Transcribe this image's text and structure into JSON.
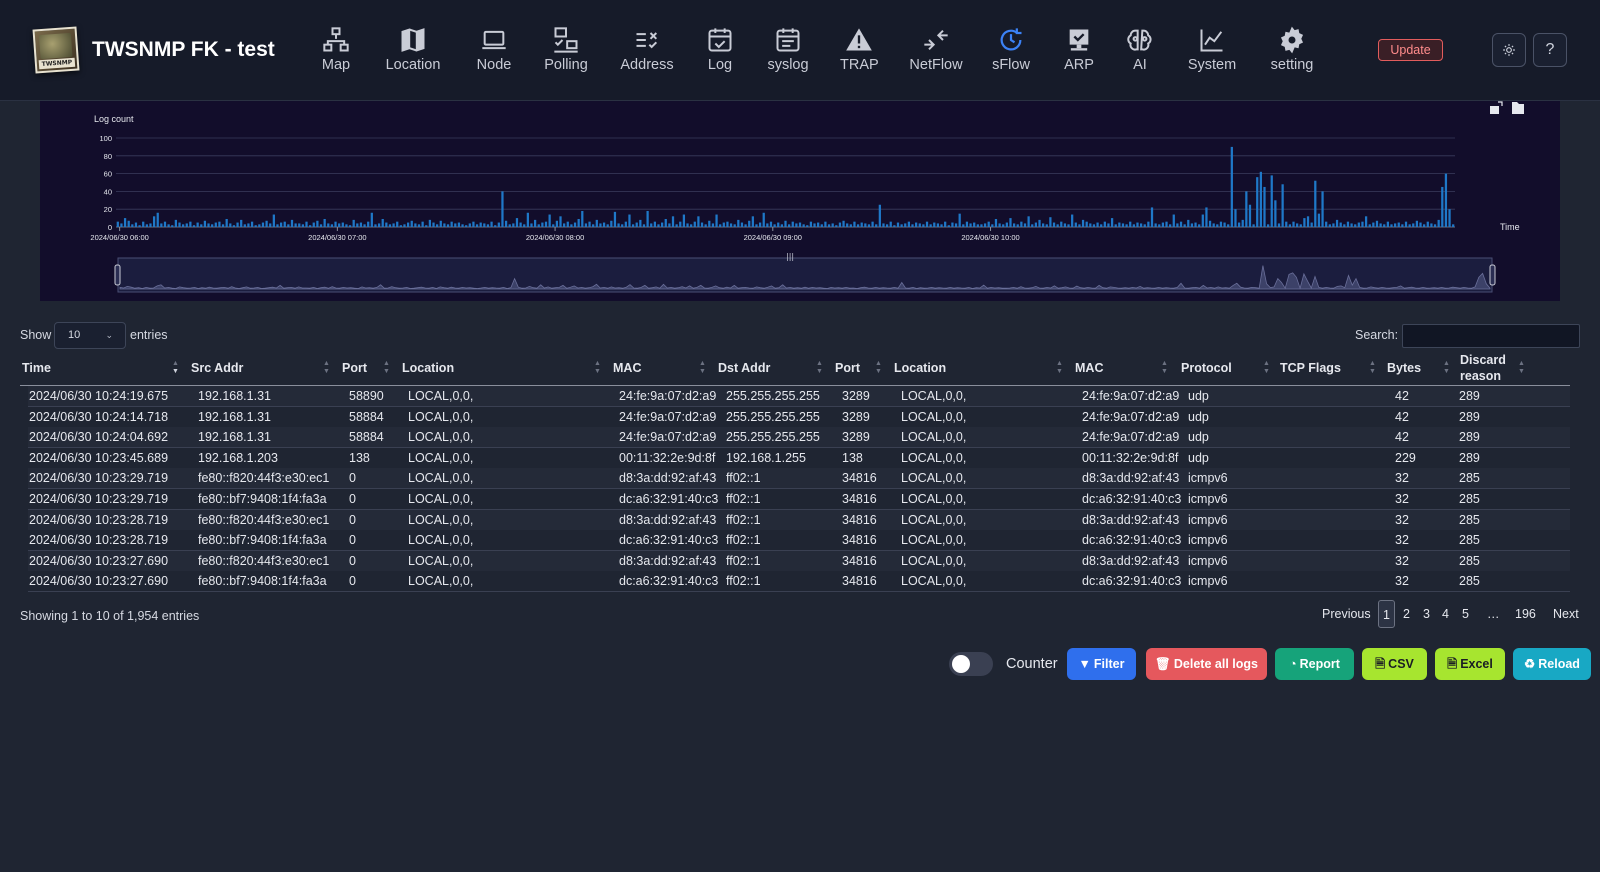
{
  "header": {
    "logo_text": "TWSNMP",
    "title": "TWSNMP FK - test",
    "nav": [
      {
        "label": "Map",
        "icon": "map-network-icon"
      },
      {
        "label": "Location",
        "icon": "map-icon"
      },
      {
        "label": "Node",
        "icon": "laptop-icon"
      },
      {
        "label": "Polling",
        "icon": "polling-icon"
      },
      {
        "label": "Address",
        "icon": "address-icon"
      },
      {
        "label": "Log",
        "icon": "calendar-check-icon"
      },
      {
        "label": "syslog",
        "icon": "calendar-icon"
      },
      {
        "label": "TRAP",
        "icon": "warning-icon"
      },
      {
        "label": "NetFlow",
        "icon": "arrows-icon"
      },
      {
        "label": "sFlow",
        "icon": "clock-icon",
        "active": true
      },
      {
        "label": "ARP",
        "icon": "monitor-check-icon"
      },
      {
        "label": "AI",
        "icon": "brain-icon"
      },
      {
        "label": "System",
        "icon": "chart-line-icon"
      },
      {
        "label": "setting",
        "icon": "gear-icon"
      }
    ],
    "update_label": "Update",
    "theme_icon": "sun-icon",
    "help_label": "?"
  },
  "chart_data": {
    "type": "bar",
    "ylabel": "Log count",
    "xlabel": "Time",
    "ylim": [
      0,
      100
    ],
    "y_ticks": [
      "0",
      "20",
      "40",
      "60",
      "80",
      "100"
    ],
    "x_ticks": [
      "2024/06/30 06:00",
      "2024/06/30 07:00",
      "2024/06/30 08:00",
      "2024/06/30 09:00",
      "2024/06/30 10:00"
    ],
    "x_range": [
      "2024/06/30 05:59",
      "2024/06/30 10:24"
    ],
    "bar_interval_minutes": 1,
    "values": [
      6,
      4,
      10,
      7,
      3,
      5,
      2,
      6,
      3,
      4,
      12,
      16,
      4,
      6,
      3,
      2,
      8,
      5,
      3,
      4,
      6,
      2,
      5,
      3,
      7,
      4,
      3,
      5,
      6,
      3,
      9,
      4,
      2,
      5,
      8,
      3,
      4,
      6,
      2,
      3,
      5,
      7,
      4,
      14,
      3,
      5,
      6,
      3,
      8,
      4,
      4,
      3,
      6,
      2,
      5,
      7,
      3,
      9,
      4,
      3,
      6,
      4,
      5,
      3,
      2,
      8,
      4,
      5,
      3,
      6,
      16,
      3,
      4,
      9,
      5,
      3,
      4,
      6,
      2,
      3,
      5,
      7,
      4,
      3,
      6,
      2,
      8,
      5,
      3,
      7,
      4,
      3,
      6,
      4,
      5,
      3,
      2,
      4,
      6,
      3,
      5,
      4,
      3,
      6,
      2,
      5,
      40,
      7,
      3,
      4,
      10,
      5,
      3,
      16,
      4,
      8,
      3,
      5,
      6,
      14,
      3,
      7,
      12,
      4,
      6,
      3,
      5,
      9,
      18,
      4,
      6,
      3,
      8,
      4,
      5,
      3,
      7,
      17,
      4,
      3,
      6,
      14,
      3,
      5,
      8,
      3,
      18,
      4,
      6,
      3,
      5,
      9,
      4,
      12,
      3,
      6,
      14,
      4,
      3,
      6,
      12,
      5,
      3,
      7,
      4,
      14,
      3,
      5,
      6,
      4,
      3,
      8,
      5,
      3,
      7,
      12,
      3,
      5,
      16,
      4,
      6,
      3,
      5,
      3,
      7,
      3,
      6,
      4,
      5,
      3,
      2,
      6,
      4,
      5,
      3,
      6,
      3,
      4,
      2,
      5,
      7,
      4,
      3,
      6,
      3,
      5,
      4,
      3,
      6,
      3,
      25,
      4,
      3,
      6,
      2,
      5,
      3,
      4,
      6,
      3,
      5,
      4,
      3,
      6,
      3,
      5,
      4,
      3,
      6,
      2,
      5,
      4,
      15,
      3,
      6,
      4,
      5,
      3,
      3,
      4,
      6,
      3,
      9,
      4,
      3,
      5,
      10,
      4,
      3,
      6,
      4,
      12,
      3,
      5,
      8,
      4,
      3,
      11,
      5,
      3,
      6,
      4,
      3,
      14,
      5,
      3,
      8,
      6,
      4,
      3,
      5,
      3,
      6,
      4,
      10,
      3,
      5,
      4,
      3,
      6,
      3,
      5,
      4,
      3,
      6,
      22,
      4,
      3,
      5,
      6,
      3,
      14,
      4,
      6,
      3,
      8,
      4,
      5,
      3,
      14,
      22,
      7,
      4,
      3,
      6,
      5,
      3,
      90,
      20,
      5,
      8,
      40,
      25,
      3,
      56,
      62,
      45,
      3,
      58,
      30,
      4,
      48,
      6,
      3,
      6,
      4,
      3,
      10,
      12,
      5,
      52,
      15,
      40,
      6,
      3,
      4,
      8,
      5,
      3,
      6,
      4,
      3,
      5,
      6,
      12,
      3,
      5,
      7,
      4,
      3,
      6,
      3,
      4,
      5,
      3,
      6,
      3,
      4,
      7,
      5,
      3,
      6,
      4,
      3,
      8,
      45,
      60,
      20,
      3
    ]
  },
  "table": {
    "show_label": "Show",
    "page_length": "10",
    "entries_label": "entries",
    "search_label": "Search:",
    "search_value": "",
    "columns": [
      "Time",
      "Src Addr",
      "Port",
      "Location",
      "MAC",
      "Dst Addr",
      "Port",
      "Location",
      "MAC",
      "Protocol",
      "TCP Flags",
      "Bytes",
      "Discard reason"
    ],
    "rows": [
      [
        "2024/06/30 10:24:19.675",
        "192.168.1.31",
        "58890",
        "LOCAL,0,0,",
        "24:fe:9a:07:d2:a9",
        "255.255.255.255",
        "3289",
        "LOCAL,0,0,",
        "24:fe:9a:07:d2:a9",
        "udp",
        "",
        "42",
        "289"
      ],
      [
        "2024/06/30 10:24:14.718",
        "192.168.1.31",
        "58884",
        "LOCAL,0,0,",
        "24:fe:9a:07:d2:a9",
        "255.255.255.255",
        "3289",
        "LOCAL,0,0,",
        "24:fe:9a:07:d2:a9",
        "udp",
        "",
        "42",
        "289"
      ],
      [
        "2024/06/30 10:24:04.692",
        "192.168.1.31",
        "58884",
        "LOCAL,0,0,",
        "24:fe:9a:07:d2:a9",
        "255.255.255.255",
        "3289",
        "LOCAL,0,0,",
        "24:fe:9a:07:d2:a9",
        "udp",
        "",
        "42",
        "289"
      ],
      [
        "2024/06/30 10:23:45.689",
        "192.168.1.203",
        "138",
        "LOCAL,0,0,",
        "00:11:32:2e:9d:8f",
        "192.168.1.255",
        "138",
        "LOCAL,0,0,",
        "00:11:32:2e:9d:8f",
        "udp",
        "",
        "229",
        "289"
      ],
      [
        "2024/06/30 10:23:29.719",
        "fe80::f820:44f3:e30:ec1",
        "0",
        "LOCAL,0,0,",
        "d8:3a:dd:92:af:43",
        "ff02::1",
        "34816",
        "LOCAL,0,0,",
        "d8:3a:dd:92:af:43",
        "icmpv6",
        "",
        "32",
        "285"
      ],
      [
        "2024/06/30 10:23:29.719",
        "fe80::bf7:9408:1f4:fa3a",
        "0",
        "LOCAL,0,0,",
        "dc:a6:32:91:40:c3",
        "ff02::1",
        "34816",
        "LOCAL,0,0,",
        "dc:a6:32:91:40:c3",
        "icmpv6",
        "",
        "32",
        "285"
      ],
      [
        "2024/06/30 10:23:28.719",
        "fe80::f820:44f3:e30:ec1",
        "0",
        "LOCAL,0,0,",
        "d8:3a:dd:92:af:43",
        "ff02::1",
        "34816",
        "LOCAL,0,0,",
        "d8:3a:dd:92:af:43",
        "icmpv6",
        "",
        "32",
        "285"
      ],
      [
        "2024/06/30 10:23:28.719",
        "fe80::bf7:9408:1f4:fa3a",
        "0",
        "LOCAL,0,0,",
        "dc:a6:32:91:40:c3",
        "ff02::1",
        "34816",
        "LOCAL,0,0,",
        "dc:a6:32:91:40:c3",
        "icmpv6",
        "",
        "32",
        "285"
      ],
      [
        "2024/06/30 10:23:27.690",
        "fe80::f820:44f3:e30:ec1",
        "0",
        "LOCAL,0,0,",
        "d8:3a:dd:92:af:43",
        "ff02::1",
        "34816",
        "LOCAL,0,0,",
        "d8:3a:dd:92:af:43",
        "icmpv6",
        "",
        "32",
        "285"
      ],
      [
        "2024/06/30 10:23:27.690",
        "fe80::bf7:9408:1f4:fa3a",
        "0",
        "LOCAL,0,0,",
        "dc:a6:32:91:40:c3",
        "ff02::1",
        "34816",
        "LOCAL,0,0,",
        "dc:a6:32:91:40:c3",
        "icmpv6",
        "",
        "32",
        "285"
      ]
    ],
    "info": "Showing 1 to 10 of 1,954 entries",
    "pagination": {
      "previous": "Previous",
      "pages": [
        "1",
        "2",
        "3",
        "4",
        "5",
        "…",
        "196"
      ],
      "current": "1",
      "next": "Next"
    }
  },
  "actions": {
    "counter_label": "Counter",
    "counter_on": false,
    "buttons": [
      {
        "label": "Filter",
        "icon": "filter-icon",
        "color": "#2f6fed"
      },
      {
        "label": "Delete all logs",
        "icon": "trash-icon",
        "color": "#e5585d"
      },
      {
        "label": "Report",
        "icon": "pie-chart-icon",
        "color": "#16a37a"
      },
      {
        "label": "CSV",
        "icon": "file-csv-icon",
        "color": "#a7e52f"
      },
      {
        "label": "Excel",
        "icon": "file-excel-icon",
        "color": "#a7e52f"
      },
      {
        "label": "Reload",
        "icon": "recycle-icon",
        "color": "#18a8c4"
      }
    ]
  },
  "colors": {
    "accent": "#3b82f6",
    "bar": "#1f78c8",
    "chart_bg": "#120d2b",
    "page_bg": "#1f2532"
  }
}
